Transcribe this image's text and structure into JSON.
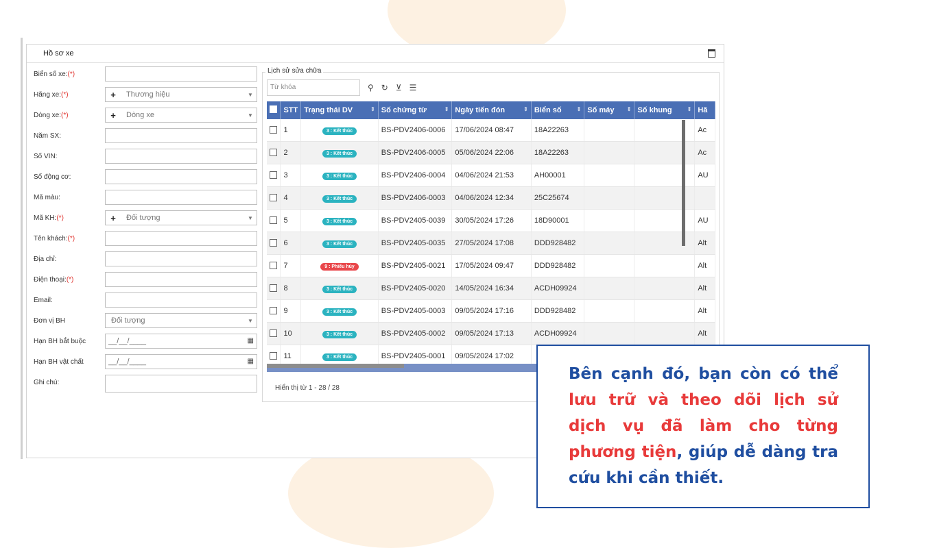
{
  "window": {
    "title": "Hồ sơ xe"
  },
  "form": {
    "fields": [
      {
        "label": "Biển số xe:",
        "required": true,
        "type": "text"
      },
      {
        "label": "Hãng xe:",
        "required": true,
        "type": "select",
        "placeholder": "Thương hiệu"
      },
      {
        "label": "Dòng xe:",
        "required": true,
        "type": "select",
        "placeholder": "Dòng xe"
      },
      {
        "label": "Năm SX:",
        "required": false,
        "type": "text"
      },
      {
        "label": "Số VIN:",
        "required": false,
        "type": "text"
      },
      {
        "label": "Số động cơ:",
        "required": false,
        "type": "text"
      },
      {
        "label": "Mã màu:",
        "required": false,
        "type": "text"
      },
      {
        "label": "Mã KH:",
        "required": true,
        "type": "select",
        "placeholder": "Đối tượng"
      },
      {
        "label": "Tên khách:",
        "required": true,
        "type": "text"
      },
      {
        "label": "Địa chỉ:",
        "required": false,
        "type": "text"
      },
      {
        "label": "Điện thoại:",
        "required": true,
        "type": "text"
      },
      {
        "label": "Email:",
        "required": false,
        "type": "text"
      },
      {
        "label": "Đơn vị BH",
        "required": false,
        "type": "select-plain",
        "placeholder": "Đối tượng"
      },
      {
        "label": "Hạn BH bắt buộc",
        "required": false,
        "type": "date",
        "placeholder": "__/__/____"
      },
      {
        "label": "Hạn BH vật chất",
        "required": false,
        "type": "date",
        "placeholder": "__/__/____"
      },
      {
        "label": "Ghi chú:",
        "required": false,
        "type": "text"
      }
    ],
    "required_mark": "(*)"
  },
  "history": {
    "legend": "Lịch sử sửa chữa",
    "search_placeholder": "Từ khóa",
    "columns": [
      "STT",
      "Trạng thái DV",
      "Số chứng từ",
      "Ngày tiến đón",
      "Biển số",
      "Số máy",
      "Số khung",
      "Hã"
    ],
    "rows": [
      {
        "stt": "1",
        "status": "3 : Kết thúc",
        "status_type": "done",
        "doc": "BS-PDV2406-0006",
        "date": "17/06/2024 08:47",
        "plate": "18A22263",
        "engine": "",
        "chassis": "",
        "brand": "Ac"
      },
      {
        "stt": "2",
        "status": "3 : Kết thúc",
        "status_type": "done",
        "doc": "BS-PDV2406-0005",
        "date": "05/06/2024 22:06",
        "plate": "18A22263",
        "engine": "",
        "chassis": "",
        "brand": "Ac"
      },
      {
        "stt": "3",
        "status": "3 : Kết thúc",
        "status_type": "done",
        "doc": "BS-PDV2406-0004",
        "date": "04/06/2024 21:53",
        "plate": "AH00001",
        "engine": "",
        "chassis": "",
        "brand": "AU"
      },
      {
        "stt": "4",
        "status": "3 : Kết thúc",
        "status_type": "done",
        "doc": "BS-PDV2406-0003",
        "date": "04/06/2024 12:34",
        "plate": "25C25674",
        "engine": "",
        "chassis": "",
        "brand": ""
      },
      {
        "stt": "5",
        "status": "3 : Kết thúc",
        "status_type": "done",
        "doc": "BS-PDV2405-0039",
        "date": "30/05/2024 17:26",
        "plate": "18D90001",
        "engine": "",
        "chassis": "",
        "brand": "AU"
      },
      {
        "stt": "6",
        "status": "3 : Kết thúc",
        "status_type": "done",
        "doc": "BS-PDV2405-0035",
        "date": "27/05/2024 17:08",
        "plate": "DDD928482",
        "engine": "",
        "chassis": "",
        "brand": "Alt"
      },
      {
        "stt": "7",
        "status": "9 : Phiếu hủy",
        "status_type": "cancel",
        "doc": "BS-PDV2405-0021",
        "date": "17/05/2024 09:47",
        "plate": "DDD928482",
        "engine": "",
        "chassis": "",
        "brand": "Alt"
      },
      {
        "stt": "8",
        "status": "3 : Kết thúc",
        "status_type": "done",
        "doc": "BS-PDV2405-0020",
        "date": "14/05/2024 16:34",
        "plate": "ACDH09924",
        "engine": "",
        "chassis": "",
        "brand": "Alt"
      },
      {
        "stt": "9",
        "status": "3 : Kết thúc",
        "status_type": "done",
        "doc": "BS-PDV2405-0003",
        "date": "09/05/2024 17:16",
        "plate": "DDD928482",
        "engine": "",
        "chassis": "",
        "brand": "Alt"
      },
      {
        "stt": "10",
        "status": "3 : Kết thúc",
        "status_type": "done",
        "doc": "BS-PDV2405-0002",
        "date": "09/05/2024 17:13",
        "plate": "ACDH09924",
        "engine": "",
        "chassis": "",
        "brand": "Alt"
      },
      {
        "stt": "11",
        "status": "3 : Kết thúc",
        "status_type": "done",
        "doc": "BS-PDV2405-0001",
        "date": "09/05/2024 17:02",
        "plate": "",
        "engine": "",
        "chassis": "",
        "brand": ""
      }
    ],
    "footer": "Hiển thị từ 1 - 28 / 28"
  },
  "callout": {
    "segments": [
      {
        "text": "Bên cạnh đó, bạn còn có thể ",
        "color": "blue"
      },
      {
        "text": "lưu trữ và theo dõi lịch sử dịch vụ đã làm cho từng phương tiện",
        "color": "red"
      },
      {
        "text": ", giúp dễ dàng tra cứu khi cần thiết.",
        "color": "blue"
      }
    ]
  },
  "colors": {
    "header_blue": "#4a6fb5",
    "badge_done": "#2bb3c0",
    "badge_cancel": "#e9474b",
    "callout_blue": "#1f4ea0",
    "callout_red": "#e83a3a"
  },
  "icons": {
    "search": "search-icon",
    "refresh": "refresh-icon",
    "filter": "filter-icon",
    "columns": "list-icon",
    "calendar": "calendar-icon"
  }
}
